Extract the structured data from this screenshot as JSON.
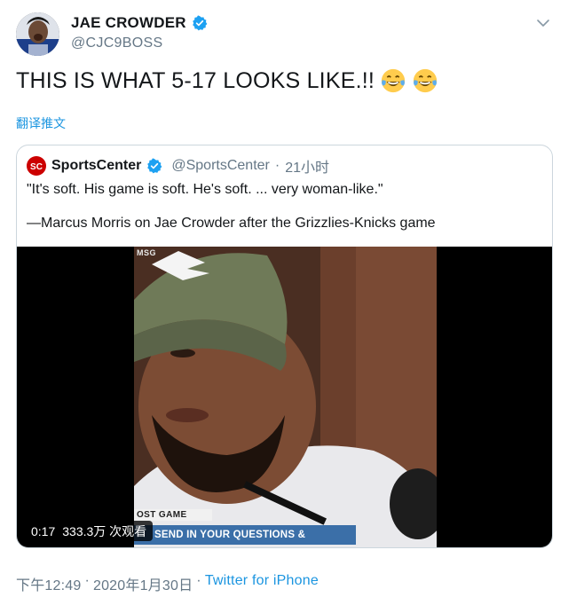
{
  "author": {
    "display_name": "JAE CROWDER",
    "handle": "@CJC9BOSS",
    "verified_icon": "verified-badge-icon",
    "menu_icon": "chevron-down-icon"
  },
  "tweet": {
    "text": "THIS IS WHAT 5-17 LOOKS LIKE.!!",
    "emojis": [
      "tears-of-joy-emoji",
      "tears-of-joy-emoji"
    ],
    "translate_label": "翻译推文"
  },
  "quoted": {
    "display_name": "SportsCenter",
    "handle": "@SportsCenter",
    "separator": "·",
    "time": "21小时",
    "text_line1": "\"It's soft. His game is soft. He's soft. ... very woman-like.\"",
    "text_line2": "—Marcus Morris on Jae Crowder after the Grizzlies-Knicks game",
    "video": {
      "network_tag": "MSG",
      "lower_third_top": "OST GAME",
      "lower_third_bottom": "SEND IN YOUR QUESTIONS & COMMENTS",
      "duration": "0:17",
      "views": "333.3万 次观看"
    }
  },
  "footer": {
    "time": "下午12:49",
    "sep1": "·",
    "date": "2020年1月30日",
    "sep2": "·",
    "source": "Twitter for iPhone"
  },
  "colors": {
    "link": "#1b95e0",
    "muted": "#657786",
    "border": "#ccd6dd",
    "lower_third_blue": "#3b6fa8"
  }
}
